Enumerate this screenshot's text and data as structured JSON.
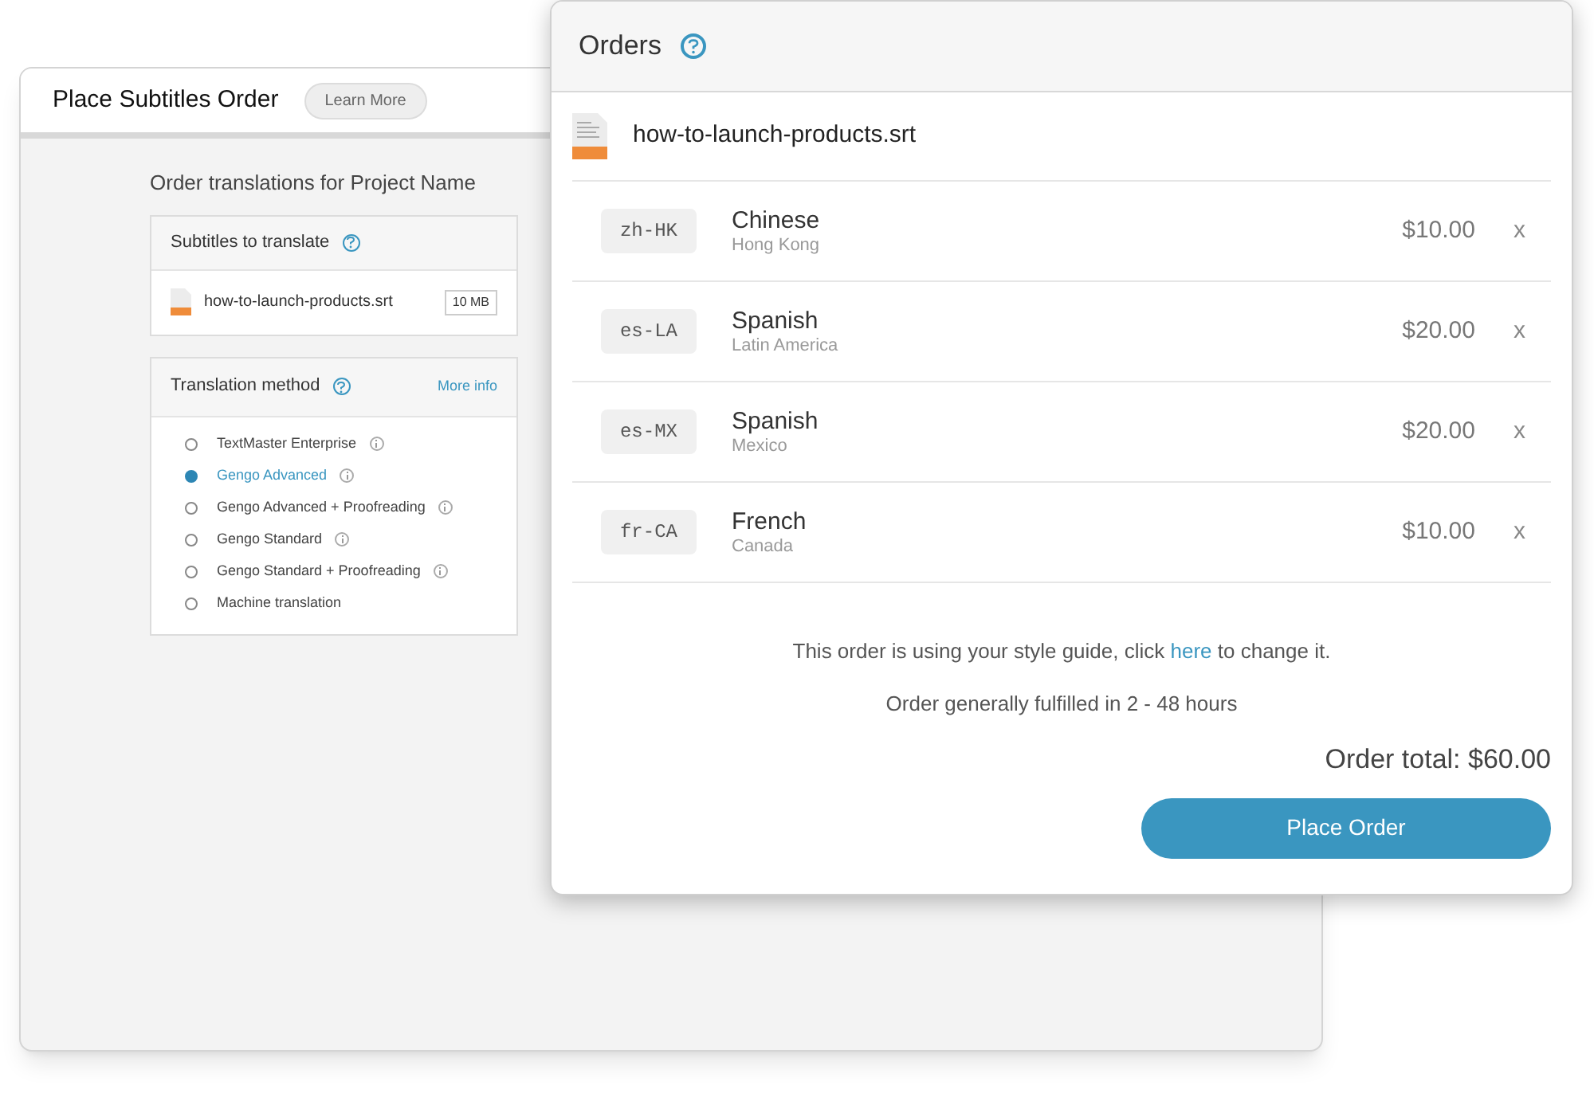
{
  "back_window": {
    "title": "Place Subtitles Order",
    "learn_more": "Learn More",
    "heading": "Order translations for Project Name",
    "subtitles_card": {
      "title": "Subtitles to translate",
      "file": {
        "name": "how-to-launch-products.srt",
        "size": "10 MB"
      }
    },
    "method_card": {
      "title": "Translation method",
      "more_info": "More info",
      "options": [
        {
          "label": "TextMaster Enterprise",
          "selected": false,
          "info": true
        },
        {
          "label": "Gengo Advanced",
          "selected": true,
          "info": true
        },
        {
          "label": "Gengo Advanced + Proofreading",
          "selected": false,
          "info": true
        },
        {
          "label": "Gengo Standard",
          "selected": false,
          "info": true
        },
        {
          "label": "Gengo Standard + Proofreading",
          "selected": false,
          "info": true
        },
        {
          "label": "Machine translation",
          "selected": false,
          "info": false
        }
      ]
    }
  },
  "orders_panel": {
    "title": "Orders",
    "file": "how-to-launch-products.srt",
    "items": [
      {
        "code": "zh-HK",
        "language": "Chinese",
        "region": "Hong Kong",
        "price": "$10.00",
        "remove": "x"
      },
      {
        "code": "es-LA",
        "language": "Spanish",
        "region": "Latin America",
        "price": "$20.00",
        "remove": "x"
      },
      {
        "code": "es-MX",
        "language": "Spanish",
        "region": "Mexico",
        "price": "$20.00",
        "remove": "x"
      },
      {
        "code": "fr-CA",
        "language": "French",
        "region": "Canada",
        "price": "$10.00",
        "remove": "x"
      }
    ],
    "style_note": {
      "before": "This order is using your style guide, click",
      "link": "here",
      "after": "to change it."
    },
    "turnaround": "Order generally fulfilled in 2 - 48 hours",
    "total": "Order total: $60.00",
    "place_order": "Place Order"
  }
}
